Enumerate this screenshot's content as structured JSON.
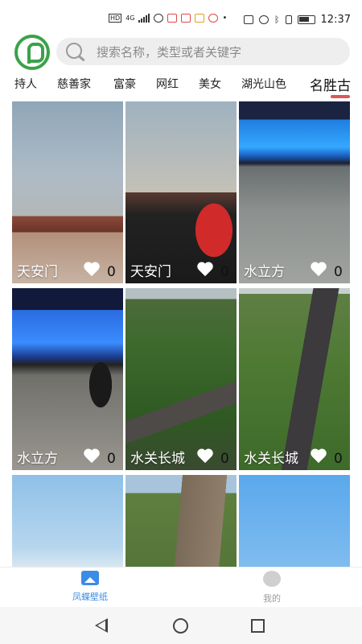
{
  "status_bar": {
    "network": "4G",
    "hd": "HD",
    "time": "12:37"
  },
  "search": {
    "placeholder": "搜索名称，类型或者关键字"
  },
  "tabs": [
    {
      "label": "持人"
    },
    {
      "label": "慈善家"
    },
    {
      "label": "富豪"
    },
    {
      "label": "网红"
    },
    {
      "label": "美女"
    },
    {
      "label": "湖光山色"
    },
    {
      "label": "名胜古",
      "active": true
    }
  ],
  "grid": [
    {
      "title": "天安门",
      "likes": "0",
      "image": "tiananmen-gate"
    },
    {
      "title": "天安门",
      "likes": "0",
      "image": "tiananmen-flag-crowd"
    },
    {
      "title": "水立方",
      "likes": "0",
      "image": "water-cube-night"
    },
    {
      "title": "水立方",
      "likes": "0",
      "image": "water-cube-plaza"
    },
    {
      "title": "水关长城",
      "likes": "0",
      "image": "great-wall-valley"
    },
    {
      "title": "水关长城",
      "likes": "0",
      "image": "great-wall-tower"
    },
    {
      "title": "",
      "likes": "",
      "image": "green-hills-sky"
    },
    {
      "title": "",
      "likes": "",
      "image": "great-wall-steps"
    },
    {
      "title": "",
      "likes": "",
      "image": "fortress-blue-sky"
    }
  ],
  "bottom_nav": [
    {
      "label": "凤蝶壁纸",
      "icon": "image-icon",
      "active": true
    },
    {
      "label": "我的",
      "icon": "profile-icon",
      "active": false
    }
  ],
  "colors": {
    "accent": "#3b8ce6",
    "brand_green": "#3aa24a",
    "tab_indicator": "#e05555"
  }
}
